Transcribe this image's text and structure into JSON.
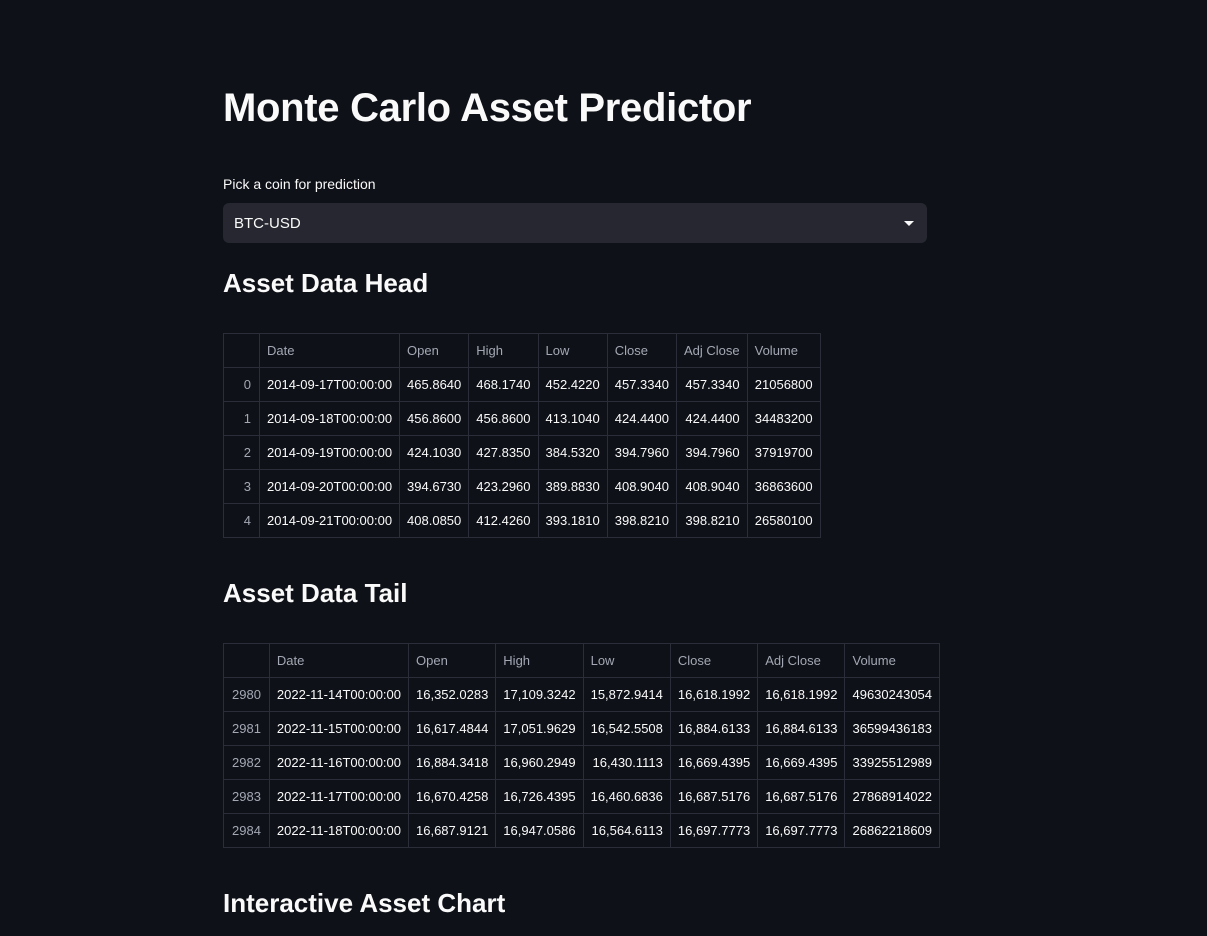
{
  "page": {
    "title": "Monte Carlo Asset Predictor"
  },
  "coin_select": {
    "label": "Pick a coin for prediction",
    "value": "BTC-USD"
  },
  "head_section": {
    "title": "Asset Data Head",
    "columns": [
      "",
      "Date",
      "Open",
      "High",
      "Low",
      "Close",
      "Adj Close",
      "Volume"
    ],
    "rows": [
      {
        "index": "0",
        "cells": [
          "2014-09-17T00:00:00",
          "465.8640",
          "468.1740",
          "452.4220",
          "457.3340",
          "457.3340",
          "21056800"
        ]
      },
      {
        "index": "1",
        "cells": [
          "2014-09-18T00:00:00",
          "456.8600",
          "456.8600",
          "413.1040",
          "424.4400",
          "424.4400",
          "34483200"
        ]
      },
      {
        "index": "2",
        "cells": [
          "2014-09-19T00:00:00",
          "424.1030",
          "427.8350",
          "384.5320",
          "394.7960",
          "394.7960",
          "37919700"
        ]
      },
      {
        "index": "3",
        "cells": [
          "2014-09-20T00:00:00",
          "394.6730",
          "423.2960",
          "389.8830",
          "408.9040",
          "408.9040",
          "36863600"
        ]
      },
      {
        "index": "4",
        "cells": [
          "2014-09-21T00:00:00",
          "408.0850",
          "412.4260",
          "393.1810",
          "398.8210",
          "398.8210",
          "26580100"
        ]
      }
    ]
  },
  "tail_section": {
    "title": "Asset Data Tail",
    "columns": [
      "",
      "Date",
      "Open",
      "High",
      "Low",
      "Close",
      "Adj Close",
      "Volume"
    ],
    "rows": [
      {
        "index": "2980",
        "cells": [
          "2022-11-14T00:00:00",
          "16,352.0283",
          "17,109.3242",
          "15,872.9414",
          "16,618.1992",
          "16,618.1992",
          "49630243054"
        ]
      },
      {
        "index": "2981",
        "cells": [
          "2022-11-15T00:00:00",
          "16,617.4844",
          "17,051.9629",
          "16,542.5508",
          "16,884.6133",
          "16,884.6133",
          "36599436183"
        ]
      },
      {
        "index": "2982",
        "cells": [
          "2022-11-16T00:00:00",
          "16,884.3418",
          "16,960.2949",
          "16,430.1113",
          "16,669.4395",
          "16,669.4395",
          "33925512989"
        ]
      },
      {
        "index": "2983",
        "cells": [
          "2022-11-17T00:00:00",
          "16,670.4258",
          "16,726.4395",
          "16,460.6836",
          "16,687.5176",
          "16,687.5176",
          "27868914022"
        ]
      },
      {
        "index": "2984",
        "cells": [
          "2022-11-18T00:00:00",
          "16,687.9121",
          "16,947.0586",
          "16,564.6113",
          "16,697.7773",
          "16,697.7773",
          "26862218609"
        ]
      }
    ]
  },
  "chart_section": {
    "title": "Interactive Asset Chart"
  },
  "colors": {
    "background": "#0e1117",
    "select_background": "#262730",
    "grid_border": "#2b2e38",
    "header_text": "#a3a8b4",
    "text": "#fafafa"
  },
  "icons": {
    "select_chevron": "chevron-down-icon"
  }
}
